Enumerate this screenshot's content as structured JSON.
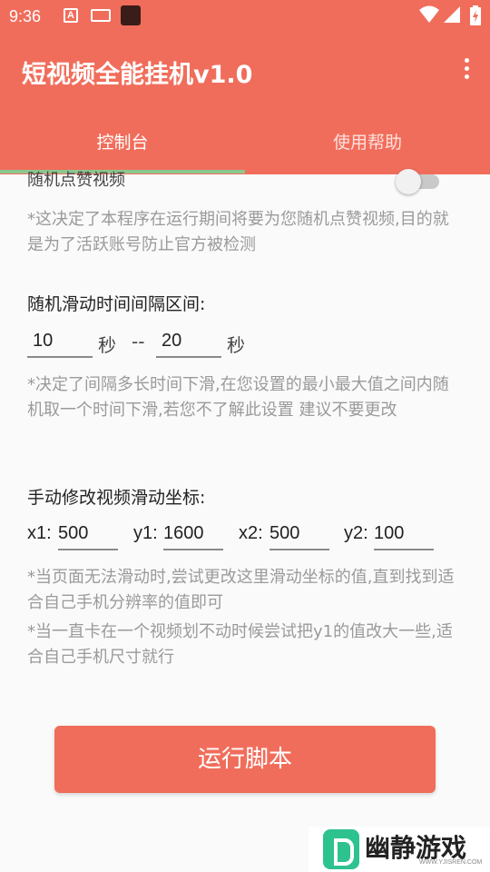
{
  "status_bar": {
    "time": "9:36"
  },
  "app": {
    "title": "短视频全能挂机v1.0",
    "accent_color": "#f16d5b",
    "menu_icon": "more-vertical-icon"
  },
  "tabs": [
    {
      "label": "控制台",
      "selected": true
    },
    {
      "label": "使用帮助",
      "selected": false
    }
  ],
  "like_setting": {
    "label": "随机点赞视频",
    "enabled": false,
    "note": "*这决定了本程序在运行期间将要为您随机点赞视频,目的就是为了活跃账号防止官方被检测"
  },
  "scroll_interval": {
    "label": "随机滑动时间间隔区间:",
    "min_value": "10",
    "min_unit": "秒",
    "separator": "--",
    "max_value": "20",
    "max_unit": "秒",
    "note": "*决定了间隔多长时间下滑,在您设置的最小最大值之间内随机取一个时间下滑,若您不了解此设置 建议不要更改"
  },
  "swipe_coords": {
    "label": "手动修改视频滑动坐标:",
    "x1_label": "x1:",
    "x1": "500",
    "y1_label": "y1:",
    "y1": "1600",
    "x2_label": "x2:",
    "x2": "500",
    "y2_label": "y2:",
    "y2": "100",
    "note1": "*当页面无法滑动时,尝试更改这里滑动坐标的值,直到找到适合自己手机分辨率的值即可",
    "note2": "*当一直卡在一个视频划不动时候尝试把y1的值改大一些,适合自己手机尺寸就行"
  },
  "run_button": {
    "label": "运行脚本"
  },
  "watermark": {
    "text": "幽静游戏",
    "url": "WWW.YJISREN.COM"
  }
}
